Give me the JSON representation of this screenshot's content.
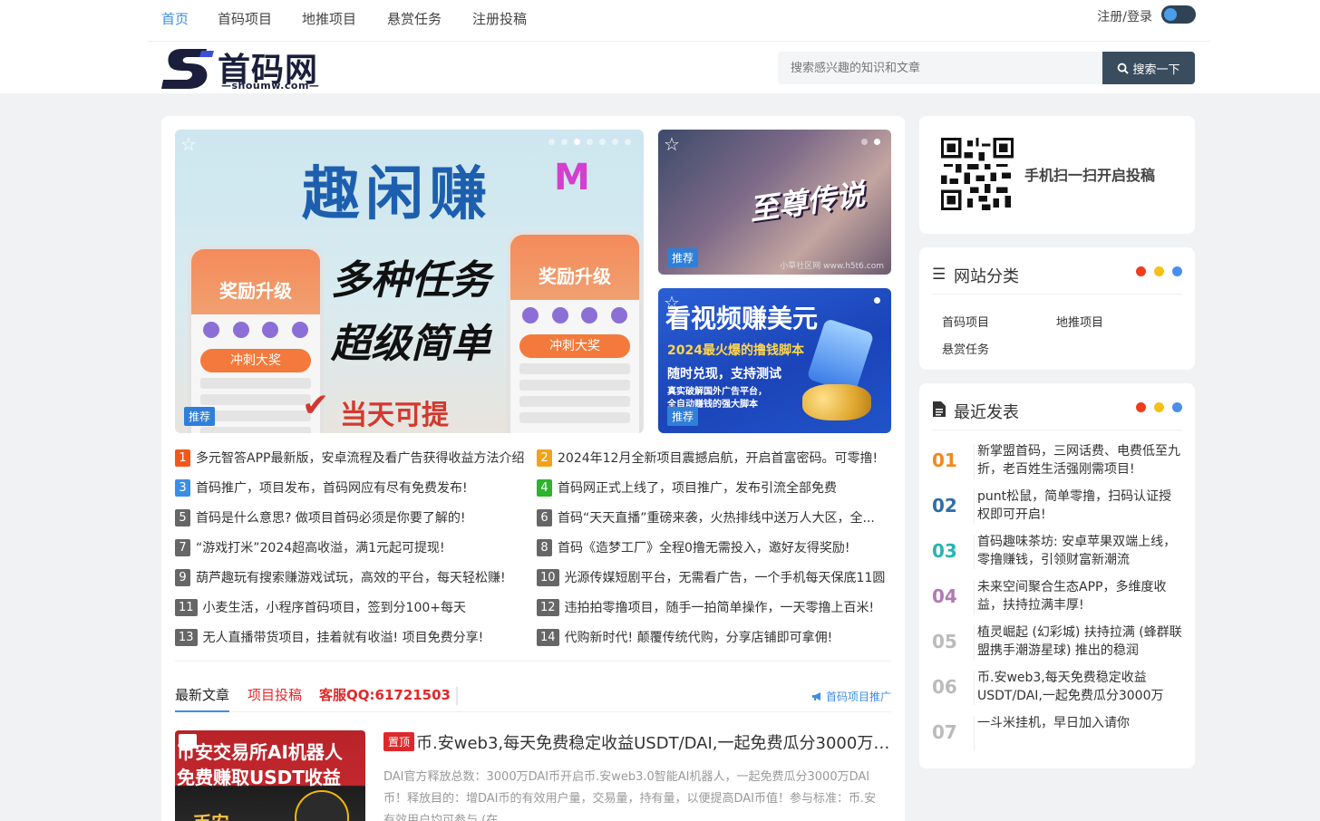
{
  "topnav": {
    "items": [
      "首页",
      "首码项目",
      "地推项目",
      "悬赏任务",
      "注册投稿"
    ],
    "login": "注册/登录"
  },
  "logo": {
    "name": "首码网",
    "domain": "—shoumw.com—"
  },
  "search": {
    "placeholder": "搜索感兴趣的知识和文章",
    "button": "搜索一下",
    "icon": "search-icon"
  },
  "slider": {
    "main": {
      "title": "趣闲赚",
      "line1": "多种任务",
      "line2": "超级简单",
      "foot": "当天可提",
      "phone_head": "奖励升级",
      "phone_btn": "冲刺大奖",
      "badge": "推荐"
    },
    "side1": {
      "title": "至尊传说",
      "watermark": "小草社区网 www.h5t6.com",
      "badge": "推荐"
    },
    "side2": {
      "title": "看视频赚美元",
      "sub": "2024最火爆的撸钱脚本",
      "line": "随时兑现，支持测试",
      "small1": "真实破解国外广告平台，",
      "small2": "全自动赚钱的强大脚本",
      "badge": "推荐"
    }
  },
  "news": [
    {
      "n": "1",
      "text": "多元智答APP最新版，安卓流程及看广告获得收益方法介绍"
    },
    {
      "n": "2",
      "text": "2024年12月全新项目震撼启航，开启首富密码。可零撸!"
    },
    {
      "n": "3",
      "text": "首码推广，项目发布，首码网应有尽有免费发布!"
    },
    {
      "n": "4",
      "text": "首码网正式上线了，项目推广，发布引流全部免费"
    },
    {
      "n": "5",
      "text": "首码是什么意思? 做项目首码必须是你要了解的!"
    },
    {
      "n": "6",
      "text": "首码“天天直播”重磅来袭，火热排线中送万人大区，全..."
    },
    {
      "n": "7",
      "text": "“游戏打米”2024超高收溢，满1元起可提现!"
    },
    {
      "n": "8",
      "text": "首码《造梦工厂》全程0撸无需投入，邀好友得奖励!"
    },
    {
      "n": "9",
      "text": "葫芦趣玩有搜索赚游戏试玩，高效的平台，每天轻松赚!"
    },
    {
      "n": "10",
      "text": "光源传媒短剧平台，无需看广告，一个手机每天保底11圆"
    },
    {
      "n": "11",
      "text": "小麦生活，小程序首码项目，签到分100+每天"
    },
    {
      "n": "12",
      "text": "违拍拍零撸项目，随手一拍简单操作，一天零撸上百米!"
    },
    {
      "n": "13",
      "text": "无人直播带货项目，挂着就有收溢! 项目免费分享!"
    },
    {
      "n": "14",
      "text": "代购新时代! 颠覆传统代购，分享店铺即可拿佣!"
    }
  ],
  "tabs": {
    "latest": "最新文章",
    "submit": "项目投稿",
    "qq": "客服QQ:61721503",
    "promo": "首码项目推广"
  },
  "article": {
    "pin": "置顶",
    "title": "币.安web3,每天免费稳定收益USDT/DAI,一起免费瓜分3000万DAI币!",
    "desc": "DAI官方释放总数：3000万DAI币开启币.安web3.0智能AI机器人，一起免费瓜分3000万DAI币！释放目的：增DAI币的有效用户量，交易量，持有量，以便提高DAI币值！参与标准：币.安有效用户均可参与 (在...",
    "thumb_line1": "币安交易所AI机器人",
    "thumb_line2": "免费赚取USDT收益",
    "thumb_line3": "币安"
  },
  "qr": {
    "text": "手机扫一扫开启投稿"
  },
  "categories": {
    "title": "网站分类",
    "items": [
      "首码项目",
      "地推项目",
      "悬赏任务"
    ]
  },
  "recent": {
    "title": "最近发表",
    "items": [
      {
        "n": "01",
        "color": "#f08a1c",
        "text": "新掌盟首码，三网话费、电费低至九折，老百姓生活强刚需项目!"
      },
      {
        "n": "02",
        "color": "#2f6fa6",
        "text": "punt松鼠，简单零撸，扫码认证授权即可开启!"
      },
      {
        "n": "03",
        "color": "#2ab3b1",
        "text": "首码趣味茶坊: 安卓苹果双端上线，零撸赚钱，引领财富新潮流"
      },
      {
        "n": "04",
        "color": "#b07ab5",
        "text": "未来空间聚合生态APP，多维度收益，扶持拉满丰厚!"
      },
      {
        "n": "05",
        "color": "#bbbbbb",
        "text": "植灵崛起 (幻彩城) 扶持拉满 (蜂群联盟携手潮游星球) 推出的稳润"
      },
      {
        "n": "06",
        "color": "#bbbbbb",
        "text": "币.安web3,每天免费稳定收益USDT/DAI,一起免费瓜分3000万"
      },
      {
        "n": "07",
        "color": "#bbbbbb",
        "text": "一斗米挂机，早日加入请你"
      }
    ]
  },
  "colors": {
    "accent": "#3c8ee4",
    "dark": "#3a4d5e",
    "red": "#e0282a",
    "dot_red": "#f23c1c",
    "dot_yellow": "#f7c116",
    "dot_blue": "#4a8ef0"
  }
}
